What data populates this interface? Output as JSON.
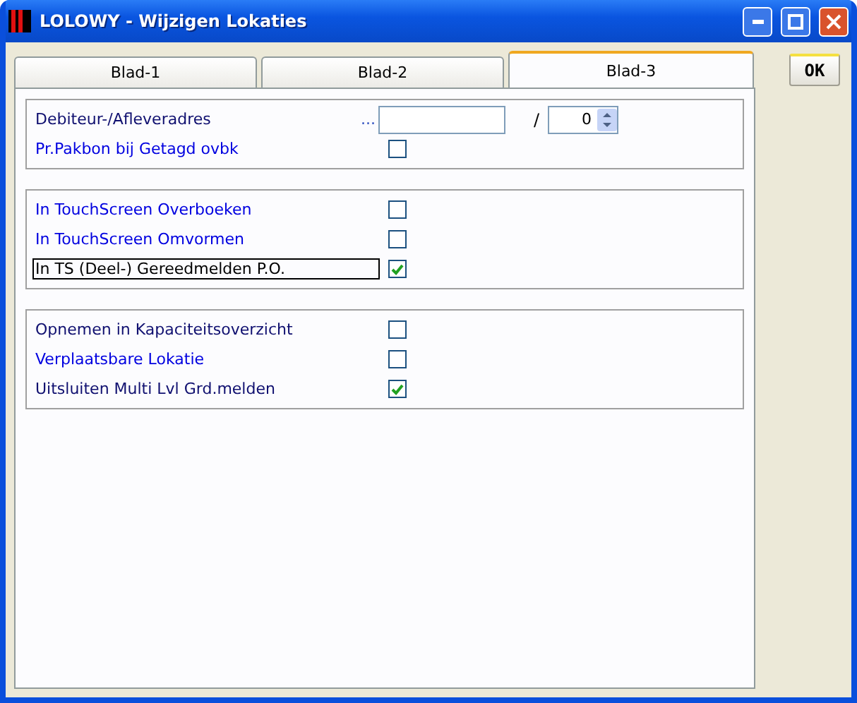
{
  "window": {
    "title": "LOLOWY - Wijzigen Lokaties"
  },
  "tabs": [
    {
      "label": "Blad-1",
      "selected": false
    },
    {
      "label": "Blad-2",
      "selected": false
    },
    {
      "label": "Blad-3",
      "selected": true
    }
  ],
  "ok_button": "OK",
  "groups": [
    {
      "rows": [
        {
          "kind": "address",
          "label": "Debiteur-/Afleveradres",
          "color": "#101070",
          "dots": "...",
          "separator": "/",
          "number": "0",
          "focused": false
        },
        {
          "kind": "checkbox",
          "label": "Pr.Pakbon bij Getagd ovbk",
          "color": "#0000e0",
          "checked": false,
          "focused": false
        }
      ]
    },
    {
      "rows": [
        {
          "kind": "checkbox",
          "label": "In TouchScreen Overboeken",
          "color": "#0000e0",
          "checked": false,
          "focused": false
        },
        {
          "kind": "checkbox",
          "label": "In TouchScreen Omvormen",
          "color": "#0000e0",
          "checked": false,
          "focused": false
        },
        {
          "kind": "checkbox",
          "label": "In TS (Deel-) Gereedmelden P.O.",
          "color": "#000000",
          "checked": true,
          "focused": true
        }
      ]
    },
    {
      "rows": [
        {
          "kind": "checkbox",
          "label": "Opnemen in Kapaciteitsoverzicht",
          "color": "#101070",
          "checked": false,
          "focused": false
        },
        {
          "kind": "checkbox",
          "label": "Verplaatsbare Lokatie",
          "color": "#0000e0",
          "checked": false,
          "focused": false
        },
        {
          "kind": "checkbox",
          "label": "Uitsluiten Multi Lvl Grd.melden",
          "color": "#101070",
          "checked": true,
          "focused": false
        }
      ]
    }
  ]
}
